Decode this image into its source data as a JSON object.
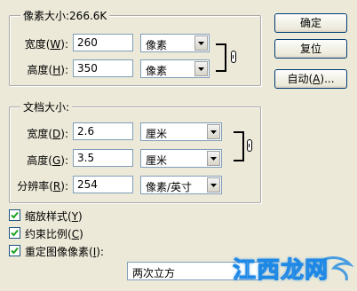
{
  "pixel_dimensions": {
    "legend": "像素大小:266.6K",
    "width": {
      "label": "宽度(",
      "key": "W",
      "end": "):",
      "value": "260",
      "unit": "像素"
    },
    "height": {
      "label": "高度(",
      "key": "H",
      "end": "):",
      "value": "350",
      "unit": "像素"
    }
  },
  "document_size": {
    "legend": "文档大小:",
    "width": {
      "label": "宽度(",
      "key": "D",
      "end": "):",
      "value": "2.6",
      "unit": "厘米"
    },
    "height": {
      "label": "高度(",
      "key": "G",
      "end": "):",
      "value": "3.5",
      "unit": "厘米"
    },
    "resolution": {
      "label": "分辨率(",
      "key": "R",
      "end": "):",
      "value": "254",
      "unit": "像素/英寸"
    }
  },
  "buttons": {
    "ok": "确定",
    "reset": "复位",
    "auto": {
      "label": "自动(",
      "key": "A",
      "end": ")..."
    }
  },
  "options": {
    "scale_styles": {
      "label": "缩放样式(",
      "key": "Y",
      "end": ")",
      "checked": true
    },
    "constrain": {
      "label": "约束比例(",
      "key": "C",
      "end": ")",
      "checked": true
    },
    "resample": {
      "label": "重定图像像素(",
      "key": "I",
      "end": "):",
      "checked": true
    }
  },
  "interpolation": {
    "value": "两次立方"
  },
  "watermark": {
    "text": "江西龙网",
    "accent": "#1e88e5",
    "icon": "dragon-logo-icon"
  },
  "colors": {
    "face": "#ece9d8",
    "border_blue": "#7f9db9",
    "button_border": "#003c74"
  }
}
